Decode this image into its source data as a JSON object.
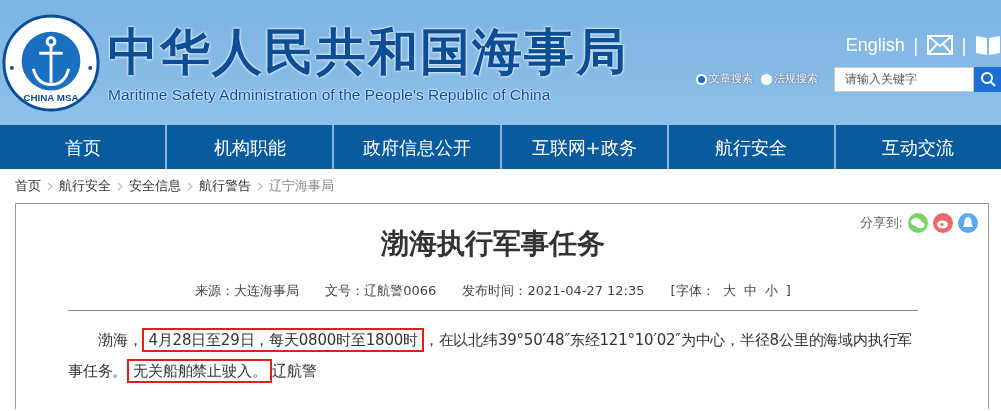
{
  "header": {
    "logo_text": "CHINA MSA",
    "title": "中华人民共和国海事局",
    "subtitle": "Maritime Safety Administration of the People's Republic of China",
    "language_link": "English",
    "dividers": [
      "|",
      "|"
    ],
    "search_modes": [
      {
        "label": "文章搜索",
        "selected": true
      },
      {
        "label": "法规搜索",
        "selected": false
      }
    ],
    "search": {
      "placeholder": "请输入关键字"
    }
  },
  "nav": [
    {
      "label": "首页"
    },
    {
      "label": "机构职能"
    },
    {
      "label": "政府信息公开"
    },
    {
      "label": "互联网+政务"
    },
    {
      "label": "航行安全"
    },
    {
      "label": "互动交流"
    }
  ],
  "breadcrumb": [
    "首页",
    "航行安全",
    "安全信息",
    "航行警告",
    "辽宁海事局"
  ],
  "article": {
    "share_label": "分享到:",
    "share_buttons": [
      {
        "kind": "wechat",
        "color": "#7bd26b"
      },
      {
        "kind": "weibo",
        "color": "#e96a6a"
      },
      {
        "kind": "qq",
        "color": "#5aa9ec"
      }
    ],
    "title": "渤海执行军事任务",
    "meta": [
      "来源：大连海事局",
      "文号：辽航警0066",
      "发布时间：2021-04-27 12:35"
    ],
    "font_label": "[字体：",
    "font_sizes": [
      "大",
      "中",
      "小"
    ],
    "font_close": "]",
    "paragraphs": [
      [
        {
          "text": "渤海，",
          "boxed": false
        },
        {
          "text": "4月28日至29日，每天0800时至1800时",
          "boxed": true
        },
        {
          "text": "，在以北纬39°50′48″东经121°10′02″为中心，半径8公里的海域内执行军事任务。",
          "boxed": false
        },
        {
          "text": "无关船舶禁止驶入。",
          "boxed": true
        },
        {
          "text": "辽航警",
          "boxed": false
        }
      ]
    ]
  }
}
